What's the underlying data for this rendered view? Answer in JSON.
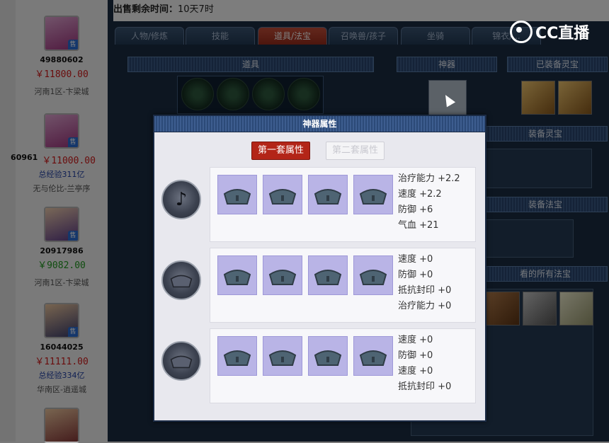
{
  "sale_time": {
    "label": "出售剩余时间：",
    "value": "10天7时"
  },
  "tabs": [
    "人物/修炼",
    "技能",
    "道具/法宝",
    "召唤兽/孩子",
    "坐骑",
    "锦衣/..."
  ],
  "sections": {
    "items": "道具",
    "artifact": "神器",
    "equipped_spirit": "已装备灵宝",
    "equipped_spirit_2": "装备灵宝",
    "equipped_magic": "装备法宝",
    "all_magic": "看的所有法宝"
  },
  "logo": {
    "text": "CC直播"
  },
  "sellers": [
    {
      "id": "49880602",
      "price": "￥11800.00",
      "price_color": "#d41a1a",
      "exp": "",
      "server": "河南1区-卞梁城"
    },
    {
      "id": "60961",
      "price": "￥11000.00",
      "price_color": "#d41a1a",
      "exp": "总经验311亿",
      "server": "无与伦比-兰亭序"
    },
    {
      "id": "20917986",
      "price": "￥9082.00",
      "price_color": "#1e9a1e",
      "exp": "",
      "server": "河南1区-卞梁城"
    },
    {
      "id": "16044025",
      "price": "￥11111.00",
      "price_color": "#d41a1a",
      "exp": "总经验334亿",
      "server": "华南区-逍遥城"
    }
  ],
  "seller_tag": "售",
  "modal": {
    "title": "神器属性",
    "set_tabs": [
      {
        "label": "第一套属性",
        "active": true
      },
      {
        "label": "第二套属性",
        "active": false
      }
    ],
    "rows": [
      {
        "icon": "artifact-flame-icon",
        "attributes": [
          "治疗能力 +2.2",
          "速度 +2.2",
          "防御 +6",
          "气血 +21"
        ]
      },
      {
        "icon": "locked-artifact-icon",
        "attributes": [
          "速度 +0",
          "防御 +0",
          "抵抗封印 +0",
          "治疗能力 +0"
        ]
      },
      {
        "icon": "locked-artifact-icon",
        "attributes": [
          "速度 +0",
          "防御 +0",
          "速度 +0",
          "抵抗封印 +0"
        ]
      }
    ]
  }
}
